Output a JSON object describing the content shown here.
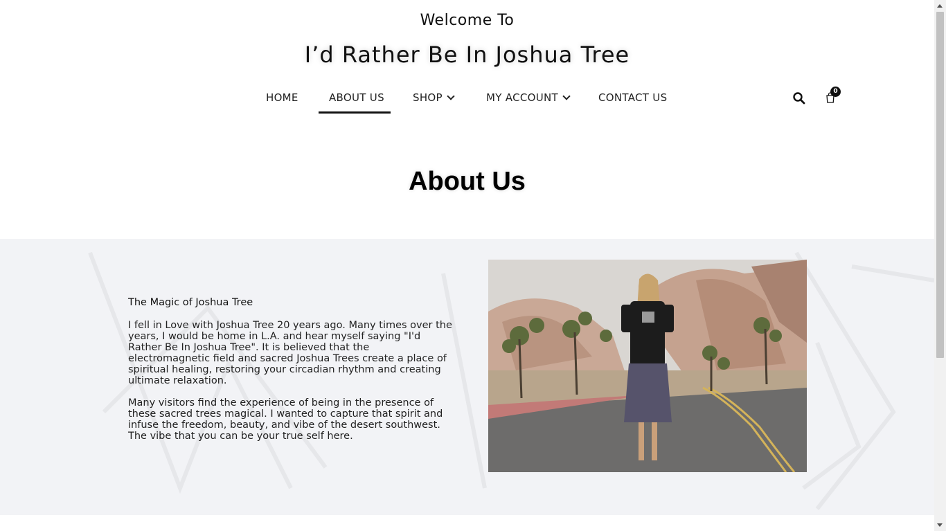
{
  "header": {
    "welcome": "Welcome To",
    "site_title": "I’d Rather Be In Joshua Tree"
  },
  "nav": {
    "items": [
      {
        "label": "HOME"
      },
      {
        "label": "ABOUT US",
        "active": true
      },
      {
        "label": "SHOP",
        "has_dropdown": true
      },
      {
        "label": "MY ACCOUNT",
        "has_dropdown": true
      },
      {
        "label": "CONTACT US"
      }
    ],
    "search_icon": "search-icon",
    "cart_icon": "shopping-bag-icon",
    "cart_count": "0"
  },
  "page": {
    "heading": "About Us"
  },
  "about": {
    "intro_heading": "The Magic of Joshua Tree",
    "paragraph_1": "I fell in Love with Joshua Tree 20 years ago. Many times over the years, I would be home in L.A. and hear myself saying \"I'd Rather Be In Joshua Tree\". It is believed that the electromagnetic field and sacred Joshua Trees create a place of spiritual healing, restoring your circadian rhythm and creating ultimate relaxation.",
    "paragraph_2": "Many visitors find the experience of being in the presence of these sacred trees magical. I wanted to capture that spirit and infuse the freedom, beauty, and vibe of the desert southwest. The vibe that you can be your true self here."
  },
  "colors": {
    "text": "#111111",
    "section_bg": "#f2f3f6",
    "badge": "#111111"
  }
}
